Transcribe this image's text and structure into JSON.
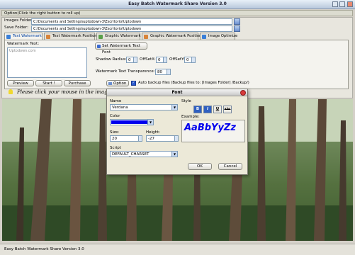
{
  "window": {
    "title": "Easy Batch Watermark Share Version 3.0"
  },
  "option_bar": {
    "text": "Option(Click the right button to roll up)"
  },
  "paths": {
    "images_label": "Images Folder:",
    "images_value": "C:\\Documents and Settings\\uptodown-3\\Escritorio\\Uptodown",
    "save_label": "Save Folder:",
    "save_value": "C:\\Documents and Settings\\uptodown-3\\Escritorio\\Uptodown"
  },
  "tabs": [
    {
      "label": "Text Watermark",
      "active": true,
      "icon_color": "#3a7fd8"
    },
    {
      "label": "Text Watermark Position",
      "active": false,
      "icon_color": "#d8843a"
    },
    {
      "label": "Graphic Watermark",
      "active": false,
      "icon_color": "#5aa04a"
    },
    {
      "label": "Graphic Watermark Position",
      "active": false,
      "icon_color": "#d8843a"
    },
    {
      "label": "Image Optimize",
      "active": false,
      "icon_color": "#3a7fd8"
    }
  ],
  "text_tab": {
    "watermark_text_label": "Watermark Text:",
    "watermark_text_value": "Uptodown.com",
    "set_font_button": "Set Watermark Text Font",
    "shadow_radius_label": "Shadow Radius:",
    "shadow_radius_value": "0",
    "offset_x_label": "OffSetX:",
    "offset_x_value": "0",
    "offset_y_label": "OffSetY:",
    "offset_y_value": "0",
    "transparence_label": "Watermark Text Transparence:",
    "transparence_value": "80"
  },
  "actions": {
    "preview": "Preview",
    "start": "Start !",
    "purchase": "Purchase",
    "option": "Option",
    "backup_label": "Auto backup files (Backup files to: [Images Folder] /Backup/)",
    "backup_checked": true
  },
  "hint": {
    "text": "Please click your mouse in the image area"
  },
  "status": {
    "text": "Easy Batch Watermark Share Version 3.0"
  },
  "font_dialog": {
    "title": "Font",
    "name_label": "Name",
    "name_value": "Verdana",
    "style_label": "Style",
    "style_buttons": [
      "B",
      "I",
      "U",
      "abc"
    ],
    "color_label": "Color",
    "color_value": "#0000ee",
    "example_label": "Example:",
    "example_text": "AaBbYyZz",
    "size_label": "Size:",
    "size_value": "20",
    "height_label": "Height:",
    "height_value": "-27",
    "script_label": "Script",
    "script_value": "DEFAULT_CHARSET",
    "ok": "OK",
    "cancel": "Cancel"
  }
}
